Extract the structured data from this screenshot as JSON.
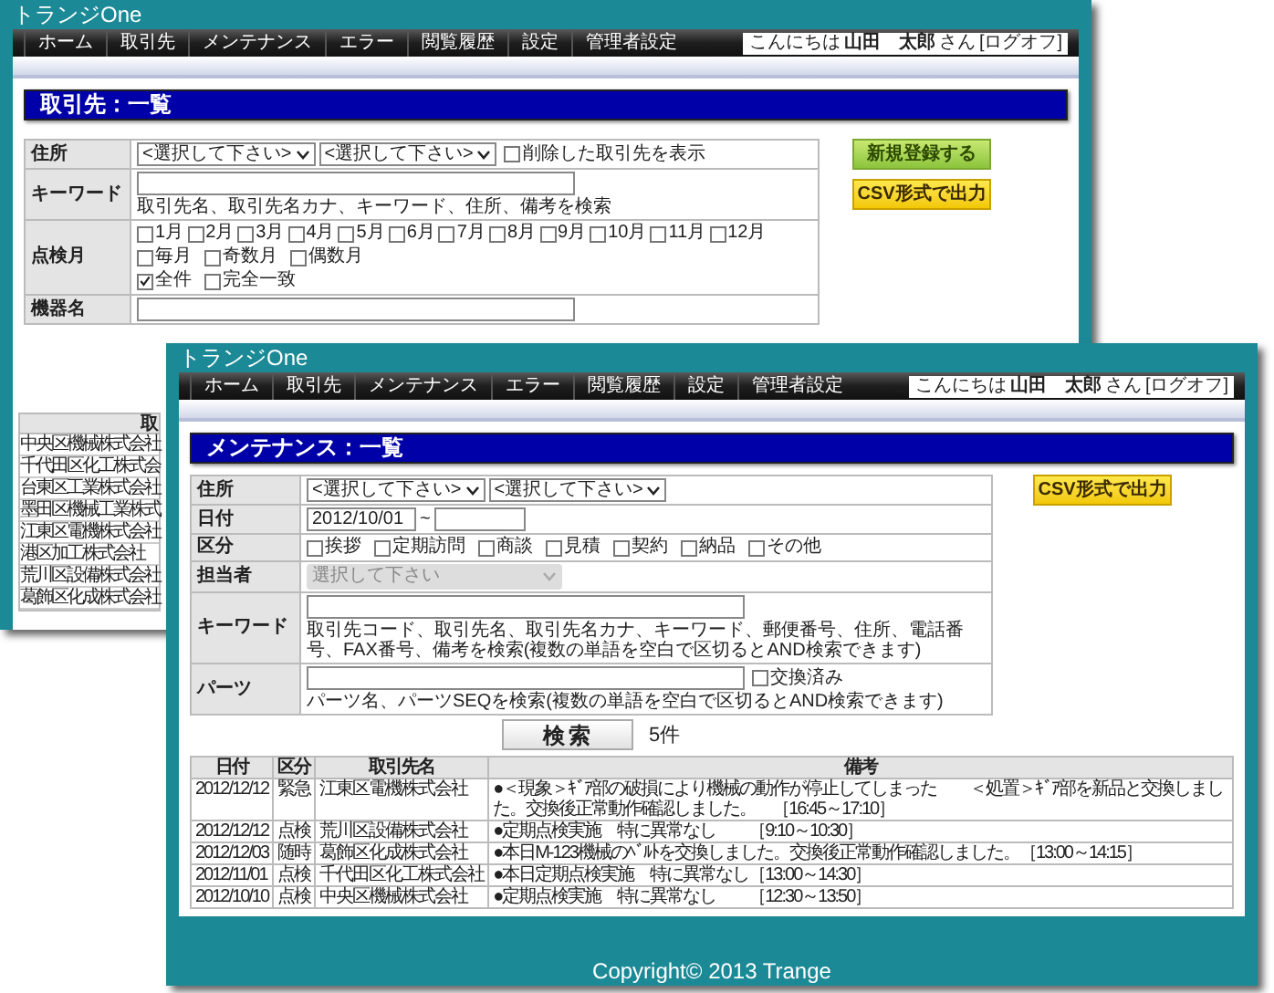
{
  "back_window": {
    "title": "トランジOne",
    "nav": [
      "ホーム",
      "取引先",
      "メンテナンス",
      "エラー",
      "閲覧履歴",
      "設定",
      "管理者設定"
    ],
    "greeting": {
      "prefix": "こんにちは",
      "name": "山田　太郎",
      "suffix": "さん",
      "logoff": "[ログオフ]"
    },
    "heading": "取引先：一覧",
    "form": [
      {
        "label": "住所",
        "kind": "selects",
        "selects": [
          "<選択して下さい>",
          "<選択して下さい>"
        ],
        "checkbox": {
          "label": "削除した取引先を表示",
          "checked": false
        }
      },
      {
        "label": "キーワード",
        "kind": "text",
        "hint": "取引先名、取引先名カナ、キーワード、住所、備考を検索"
      },
      {
        "label": "点検月",
        "kind": "checks",
        "lines": [
          [
            {
              "label": "1月",
              "checked": false
            },
            {
              "label": "2月",
              "checked": false
            },
            {
              "label": "3月",
              "checked": false
            },
            {
              "label": "4月",
              "checked": false
            },
            {
              "label": "5月",
              "checked": false
            },
            {
              "label": "6月",
              "checked": false
            },
            {
              "label": "7月",
              "checked": false
            },
            {
              "label": "8月",
              "checked": false
            },
            {
              "label": "9月",
              "checked": false
            },
            {
              "label": "10月",
              "checked": false
            },
            {
              "label": "11月",
              "checked": false
            },
            {
              "label": "12月",
              "checked": false
            }
          ],
          [
            {
              "label": "毎月",
              "checked": false
            },
            {
              "label": "奇数月",
              "checked": false
            },
            {
              "label": "偶数月",
              "checked": false
            }
          ],
          [
            {
              "label": "全件",
              "checked": true
            },
            {
              "label": "完全一致",
              "checked": false
            }
          ]
        ]
      },
      {
        "label": "機器名",
        "kind": "text"
      }
    ],
    "buttons": [
      {
        "label": "新規登録する",
        "kind": "new"
      },
      {
        "label": "CSV形式で出力",
        "kind": "csv"
      }
    ],
    "list": {
      "column_1": "取",
      "rows": [
        "中央区機械株式会社",
        "千代田区化工株式会",
        "台東区工業株式会社",
        "墨田区機械工業株式",
        "江東区電機株式会社",
        "港区加工株式会社",
        "荒川区設備株式会社",
        "葛飾区化成株式会社"
      ]
    }
  },
  "front_window": {
    "title": "トランジOne",
    "nav": [
      "ホーム",
      "取引先",
      "メンテナンス",
      "エラー",
      "閲覧履歴",
      "設定",
      "管理者設定"
    ],
    "greeting": {
      "prefix": "こんにちは",
      "name": "山田　太郎",
      "suffix": "さん",
      "logoff": "[ログオフ]"
    },
    "heading": "メンテナンス：一覧",
    "form": [
      {
        "label": "住所",
        "kind": "selects",
        "selects": [
          "<選択して下さい>",
          "<選択して下さい>"
        ]
      },
      {
        "label": "日付",
        "kind": "range",
        "from": "2012/10/01",
        "separator": "~"
      },
      {
        "label": "区分",
        "kind": "checks",
        "lines": [
          [
            {
              "label": "挨拶",
              "checked": false
            },
            {
              "label": "定期訪問",
              "checked": false
            },
            {
              "label": "商談",
              "checked": false
            },
            {
              "label": "見積",
              "checked": false
            },
            {
              "label": "契約",
              "checked": false
            },
            {
              "label": "納品",
              "checked": false
            },
            {
              "label": "その他",
              "checked": false
            }
          ]
        ]
      },
      {
        "label": "担当者",
        "kind": "dropdown",
        "placeholder": "選択して下さい",
        "disabled": true
      },
      {
        "label": "キーワード",
        "kind": "text",
        "hint": "取引先コード、取引先名、取引先名カナ、キーワード、郵便番号、住所、電話番号、FAX番号、備考を検索(複数の単語を空白で区切るとAND検索できます)"
      },
      {
        "label": "パーツ",
        "kind": "text",
        "checkbox": {
          "label": "交換済み",
          "checked": false
        },
        "hint": "パーツ名、パーツSEQを検索(複数の単語を空白で区切るとAND検索できます)"
      }
    ],
    "buttons": [
      {
        "label": "CSV形式で出力",
        "kind": "csv"
      }
    ],
    "search": {
      "button": "検索",
      "count": "5件"
    },
    "table": {
      "columns": [
        "日付",
        "区分",
        "取引先名",
        "備考"
      ],
      "rows": [
        [
          "2012/12/12",
          "緊急",
          "江東区電機株式会社",
          "●＜現象＞ｷﾞｱ部の破損により機械の動作が停止してしまった　　＜処置＞ｷﾞｱ部を新品と交換しました。交換後正常動作確認しました。　［16:45～17:10］"
        ],
        [
          "2012/12/12",
          "点検",
          "荒川区設備株式会社",
          "●定期点検実施　特に異常なし　　［9:10～10:30］"
        ],
        [
          "2012/12/03",
          "随時",
          "葛飾区化成株式会社",
          "●本日M-123機械のﾍﾞﾙﾄを交換しました。交換後正常動作確認しました。［13:00～14:15］"
        ],
        [
          "2012/11/01",
          "点検",
          "千代田区化工株式会社",
          "●本日定期点検実施　特に異常なし［13:00～14:30］"
        ],
        [
          "2012/10/10",
          "点検",
          "中央区機械株式会社",
          "●定期点検実施　特に異常なし　　［12:30～13:50］"
        ]
      ]
    },
    "footer": "Copyright© 2013 Trange"
  }
}
